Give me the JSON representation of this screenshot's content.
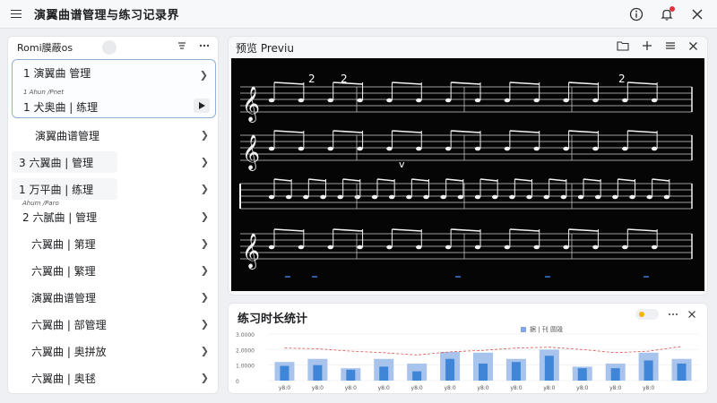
{
  "app": {
    "title": "演翼曲谱管理与练习记录界"
  },
  "icons": {
    "menu": "hamburger-menu-icon",
    "info": "info-icon",
    "notification": "bell-icon",
    "close": "close-icon"
  },
  "left_panel": {
    "title": "Romi膜蔽os",
    "items": [
      {
        "title": "1 演翼曲 管理",
        "sub": "1 Ahun /Pnet",
        "line2": "1 犬奥曲 | 练理",
        "selected": true
      },
      {
        "title": "演翼曲谱管理"
      },
      {
        "title": "3 六翼曲 | 管理",
        "boxed": true
      },
      {
        "title": "1 万平曲 | 练理",
        "boxed": true,
        "sub": "Ahum /Paro"
      },
      {
        "title": "2 六膩曲 | 管理"
      },
      {
        "title": "六翼曲 | 第理"
      },
      {
        "title": "六翼曲 | 繁理"
      },
      {
        "title": "演翼曲谱管理"
      },
      {
        "title": "六翼曲 | 部管理"
      },
      {
        "title": "六翼曲 | 奥拼放"
      },
      {
        "title": "六翼曲 | 奥毬"
      }
    ]
  },
  "preview": {
    "title": "预览 Previu",
    "marks": {
      "num2a": "2",
      "num2b": "2",
      "num2c": "2",
      "v": "v"
    }
  },
  "stats": {
    "title": "练习时长统计",
    "legend": "据 | 刊 圆毁"
  },
  "colors": {
    "bar_light": "#a9c4ec",
    "bar_dark": "#3f86d8",
    "trend": "#d9534f",
    "accent": "#e0333a"
  },
  "chart_data": {
    "type": "bar",
    "ylabels": [
      "3.0000",
      "2.0000",
      "1.0000",
      "0"
    ],
    "ylim": [
      0,
      30000
    ],
    "categories": [
      "y8:0",
      "y8:0",
      "y8:0",
      "y8:0",
      "y8:0",
      "y8:0",
      "y8:0",
      "y8:0",
      "y8:0",
      "y8:0",
      "y8:0",
      "y8:0"
    ],
    "series": [
      {
        "name": "",
        "values": [
          12000,
          14000,
          8000,
          14000,
          11000,
          18500,
          18000,
          14000,
          20000,
          9000,
          11000,
          18000,
          14000
        ]
      },
      {
        "name": "",
        "values": [
          9500,
          10000,
          7000,
          9000,
          6000,
          14000,
          11000,
          12000,
          16000,
          8000,
          8000,
          13000,
          11000
        ]
      }
    ],
    "trend": [
      21000,
      20500,
      19000,
      18000,
      16500,
      18500,
      19500,
      21000,
      21500,
      20000,
      18000,
      19000,
      22000
    ]
  }
}
